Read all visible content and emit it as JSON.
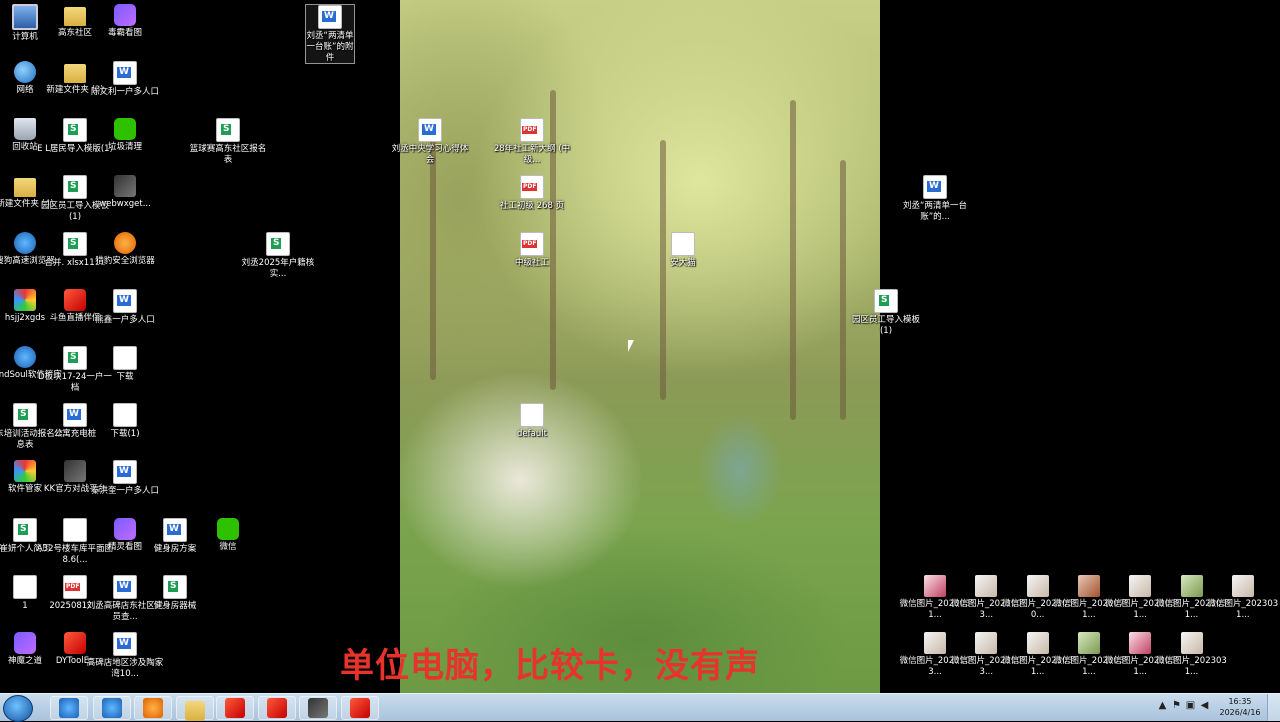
{
  "desktop": {
    "left_icons": [
      {
        "label": "计算机",
        "kind": "pc"
      },
      {
        "label": "高东社区",
        "kind": "folder"
      },
      {
        "label": "毒霸看图",
        "kind": "app-purple"
      },
      {
        "label": "网络",
        "kind": "net"
      },
      {
        "label": "新建文件夹 (3)",
        "kind": "folder"
      },
      {
        "label": "陈文利一户多人口",
        "kind": "doc"
      },
      {
        "label": "回收站",
        "kind": "bin"
      },
      {
        "label": "E L居民导入模版(1)",
        "kind": "xls"
      },
      {
        "label": "垃圾清理",
        "kind": "app-green"
      },
      {
        "label": "篮球赛高东社区报名表",
        "kind": "xls"
      },
      {
        "label": "新建文件夹 (4)",
        "kind": "folder"
      },
      {
        "label": "园区员工导入模板 (1)",
        "kind": "xls"
      },
      {
        "label": "webwxget...",
        "kind": "app-dark"
      },
      {
        "label": "搜狗高速浏览器",
        "kind": "app-blue"
      },
      {
        "label": "合并. xlsx1111",
        "kind": "xls"
      },
      {
        "label": "猎豹安全浏览器",
        "kind": "app-orange"
      },
      {
        "label": "刘丞2025年户籍核实...",
        "kind": "xls"
      },
      {
        "label": "hsjj2xgds",
        "kind": "app-multi"
      },
      {
        "label": "斗鱼直播伴侣",
        "kind": "app-red"
      },
      {
        "label": "熊鑫一户多人口",
        "kind": "doc"
      },
      {
        "label": "WindSoul软件管家",
        "kind": "app-blue"
      },
      {
        "label": "D板块17-24一户一档",
        "kind": "xls"
      },
      {
        "label": "下载",
        "kind": "blank"
      },
      {
        "label": "高东培训活动报名信息表",
        "kind": "xls"
      },
      {
        "label": "公寓充电桩",
        "kind": "doc"
      },
      {
        "label": "下载(1)",
        "kind": "blank"
      },
      {
        "label": "软件管家",
        "kind": "app-multi"
      },
      {
        "label": "KK官方对战平台",
        "kind": "app-dark"
      },
      {
        "label": "秦洪奎一户多人口",
        "kind": "doc"
      },
      {
        "label": "崔妍个人简历",
        "kind": "xls"
      },
      {
        "label": "A32号楼车库平面图8.6(...",
        "kind": "blank"
      },
      {
        "label": "精灵看图",
        "kind": "app-purple"
      },
      {
        "label": "健身房方案",
        "kind": "doc"
      },
      {
        "label": "微信",
        "kind": "app-green"
      },
      {
        "label": "1",
        "kind": "blank"
      },
      {
        "label": "20250812...",
        "kind": "pdf"
      },
      {
        "label": "刘丞高碑店东社区党员查...",
        "kind": "doc"
      },
      {
        "label": "健身房器械",
        "kind": "xls"
      },
      {
        "label": "神魔之道",
        "kind": "app-purple"
      },
      {
        "label": "DYToolEx",
        "kind": "app-red"
      },
      {
        "label": "高碑店地区涉及陶家湾10...",
        "kind": "doc"
      }
    ],
    "top_selected_icon": {
      "label": "刘丞“两清单一台账”的附件",
      "kind": "doc"
    },
    "wallpaper_icons": [
      {
        "label": "刘丞中央学习心得体会",
        "kind": "doc"
      },
      {
        "label": "28年社工新大纲 (中级...",
        "kind": "pdf"
      },
      {
        "label": "社工初级 268 页",
        "kind": "pdf"
      },
      {
        "label": "中级社工",
        "kind": "pdf"
      },
      {
        "label": "安大猫",
        "kind": "blank"
      },
      {
        "label": "default",
        "kind": "blank"
      }
    ],
    "right_icons": [
      {
        "label": "刘丞“两清单一台账”的...",
        "kind": "doc"
      },
      {
        "label": "园区员工导入模板 (1)",
        "kind": "xls"
      }
    ],
    "photo_icons": [
      {
        "label": "微信图片_2023031...",
        "kind": "photo4"
      },
      {
        "label": "微信图片_2023103...",
        "kind": "photo2"
      },
      {
        "label": "微信图片_2023050...",
        "kind": "photo2"
      },
      {
        "label": "微信图片_2020071...",
        "kind": "photo"
      },
      {
        "label": "微信图片_2023031...",
        "kind": "photo2"
      },
      {
        "label": "微信图片_2023031...",
        "kind": "photo3"
      },
      {
        "label": "微信图片_2023031...",
        "kind": "photo2"
      },
      {
        "label": "微信图片_2023103...",
        "kind": "photo2"
      },
      {
        "label": "微信图片_2023103...",
        "kind": "photo2"
      },
      {
        "label": "微信图片_2023031...",
        "kind": "photo2"
      },
      {
        "label": "微信图片_2023031...",
        "kind": "photo3"
      },
      {
        "label": "微信图片_2023031...",
        "kind": "photo4"
      },
      {
        "label": "微信图片_2023031...",
        "kind": "photo2"
      }
    ]
  },
  "subtitle": "单位电脑，比较卡，没有声",
  "taskbar": {
    "pinned": [
      {
        "name": "sogou-browser",
        "kind": "app-blue"
      },
      {
        "name": "kk-app",
        "kind": "app-blue"
      },
      {
        "name": "cheetah-browser",
        "kind": "app-orange"
      },
      {
        "name": "file-explorer",
        "kind": "folder"
      },
      {
        "name": "game-app",
        "kind": "app-red"
      },
      {
        "name": "wps-office",
        "kind": "app-red"
      },
      {
        "name": "game-app-2",
        "kind": "app-dark"
      },
      {
        "name": "douyu-app",
        "kind": "app-red"
      }
    ],
    "clock_time": "16:35",
    "clock_date": "2026/4/16"
  }
}
